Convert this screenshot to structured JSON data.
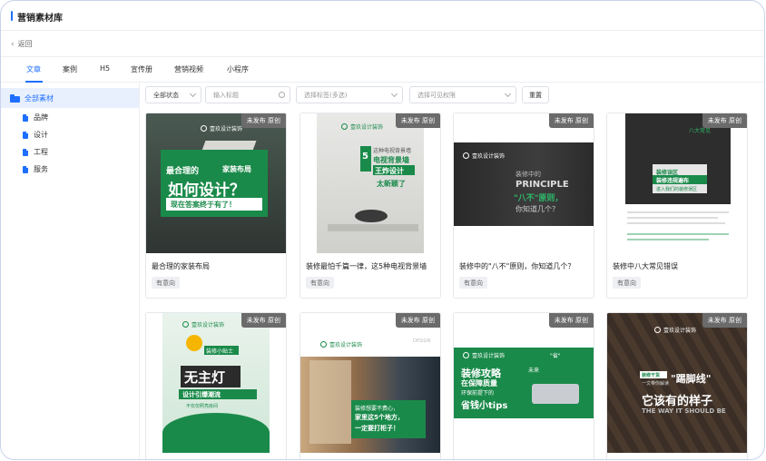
{
  "page": {
    "title": "营销素材库",
    "back_label": "返回"
  },
  "tabs": [
    {
      "label": "文章",
      "active": true
    },
    {
      "label": "案例"
    },
    {
      "label": "H5"
    },
    {
      "label": "宣传册"
    },
    {
      "label": "营销视频"
    },
    {
      "label": "小程序"
    }
  ],
  "sidebar": {
    "root": "全部素材",
    "items": [
      "品牌",
      "设计",
      "工程",
      "服务"
    ]
  },
  "filters": {
    "status_value": "全部状态",
    "title_placeholder": "输入标题",
    "tags_placeholder": "选择标签(多选)",
    "visible_placeholder": "选择可见权限",
    "reset_label": "重置"
  },
  "badge_text": "未发布 原创",
  "tag_text": "有意向",
  "brand": "壹玖设计装饰",
  "cards": [
    {
      "title": "最合理的家装布局",
      "lines": [
        "最合理的",
        "家装布局",
        "如何设计？",
        "现在答案终于有了！"
      ]
    },
    {
      "title": "装修最怕千篇一律，这5种电视背景墙",
      "lines": [
        "这种电视背景墙",
        "5",
        "电视背景墙",
        "王炸设计",
        "太新颖了"
      ]
    },
    {
      "title": "装修中的\"八不\"原则，你知道几个？",
      "lines": [
        "装修中的",
        "PRINCIPLE",
        "\"八不\"原则，",
        "你知道几个？"
      ]
    },
    {
      "title": "装修中八大常见错误",
      "lines": [
        "八大常见",
        "装修误区",
        "装修违规遍布",
        "进入我们的装修误区"
      ]
    },
    {
      "title": "",
      "lines": [
        "装修小贴士",
        "无主灯",
        "设计引爆潮流",
        "不仅仅照亮房间"
      ]
    },
    {
      "title": "",
      "lines": [
        "DESIGN",
        "装修想要不费心，",
        "家里这5个地方，",
        "一定要打柜子！"
      ]
    },
    {
      "title": "",
      "lines": [
        "装修攻略",
        "在保障质量",
        "环保前提下的",
        "省钱小tips",
        "\"省\"",
        "未来"
      ]
    },
    {
      "title": "",
      "lines": [
        "装修干货",
        "一文带你解读",
        "\"踢脚线\"",
        "它该有的样子",
        "THE WAY IT SHOULD BE"
      ]
    }
  ],
  "colors": {
    "accent": "#1f6fff",
    "green": "#1a8a4a",
    "badge": "#6b6b6b"
  }
}
